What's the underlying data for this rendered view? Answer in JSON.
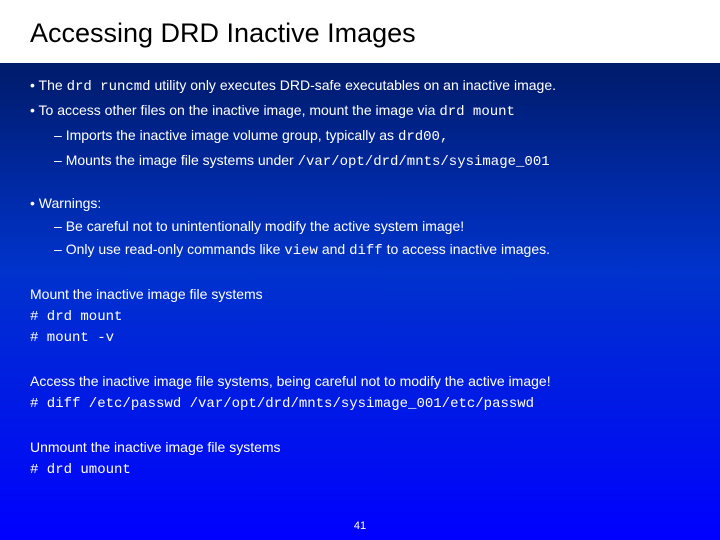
{
  "title": "Accessing DRD Inactive Images",
  "b1a": "The ",
  "b1b": "drd runcmd",
  "b1c": " utility only executes DRD-safe executables on an inactive image.",
  "b2a": "To access other files on the inactive image, mount the image via ",
  "b2b": "drd mount",
  "b3a": "Imports the inactive image volume group, typically as ",
  "b3b": "drd00,",
  "b4a": "Mounts the image file systems under ",
  "b4b": "/var/opt/drd/mnts/sysimage_001",
  "b5": "Warnings:",
  "b6": "Be careful not to unintentionally modify the active system image!",
  "b7a": "Only use read-only commands like ",
  "b7b": "view",
  "b7c": " and ",
  "b7d": "diff",
  "b7e": " to access inactive images.",
  "s1h": "Mount the inactive image file systems",
  "s1c1": "# drd mount",
  "s1c2": "# mount -v",
  "s2h": "Access the inactive image file systems, being careful not to modify the active image!",
  "s2c1": "# diff /etc/passwd /var/opt/drd/mnts/sysimage_001/etc/passwd",
  "s3h": "Unmount the inactive image file systems",
  "s3c1": "# drd umount",
  "page": "41"
}
